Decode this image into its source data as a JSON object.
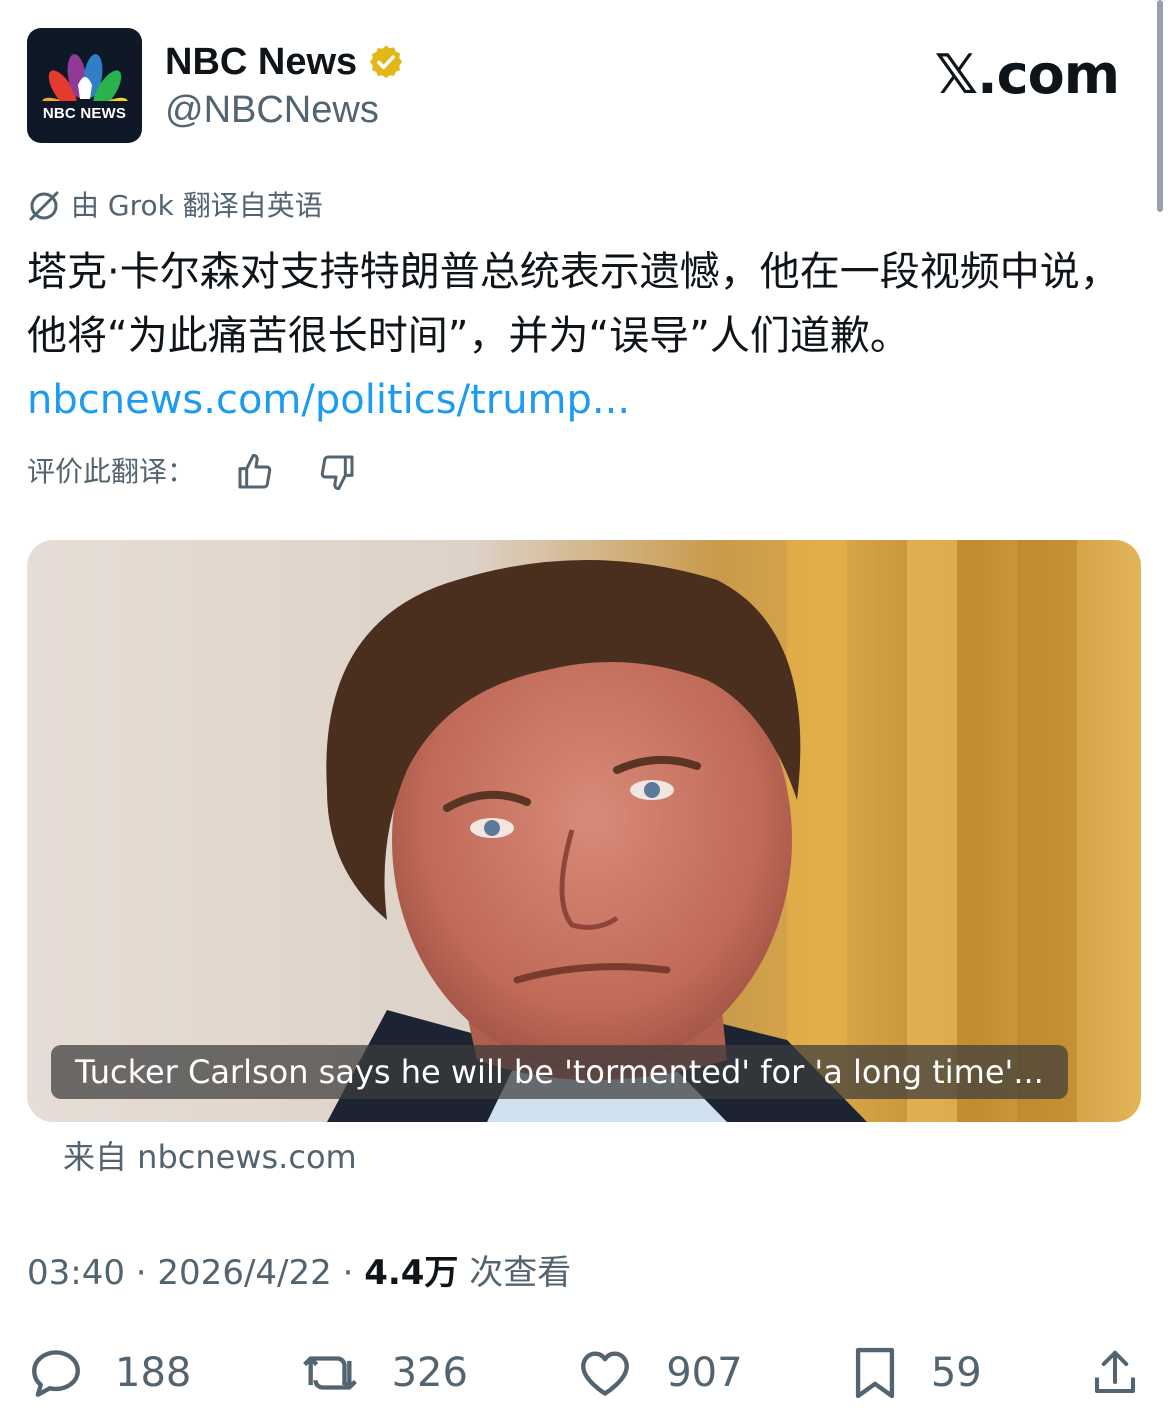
{
  "header": {
    "avatar_text": "NBC NEWS",
    "display_name": "NBC News",
    "handle": "@NBCNews",
    "verified_icon": "verified-badge-icon",
    "brand": "𝕏.com"
  },
  "translation": {
    "note": "由 Grok 翻译自英语",
    "icon": "grok-icon"
  },
  "tweet": {
    "text": "塔克·卡尔森对支持特朗普总统表示遗憾，他在一段视频中说，他将“为此痛苦很长时间”，并为“误导”人们道歉。",
    "link": "nbcnews.com/politics/trump..."
  },
  "rating": {
    "label": "评价此翻译：",
    "thumbs_up_icon": "thumbs-up-icon",
    "thumbs_down_icon": "thumbs-down-icon"
  },
  "media": {
    "caption": "Tucker Carlson says he will be 'tormented' for 'a long time'...",
    "source": "来自 nbcnews.com"
  },
  "meta": {
    "time": "03:40",
    "separator": " · ",
    "date": "2026/4/22",
    "views": "4.4万",
    "views_label": " 次查看"
  },
  "actions": {
    "reply": "188",
    "repost": "326",
    "like": "907",
    "bookmark": "59"
  },
  "colors": {
    "text": "#0f1419",
    "secondary": "#536471",
    "link": "#1d9bf0",
    "verified_gold": "#e2b719"
  }
}
